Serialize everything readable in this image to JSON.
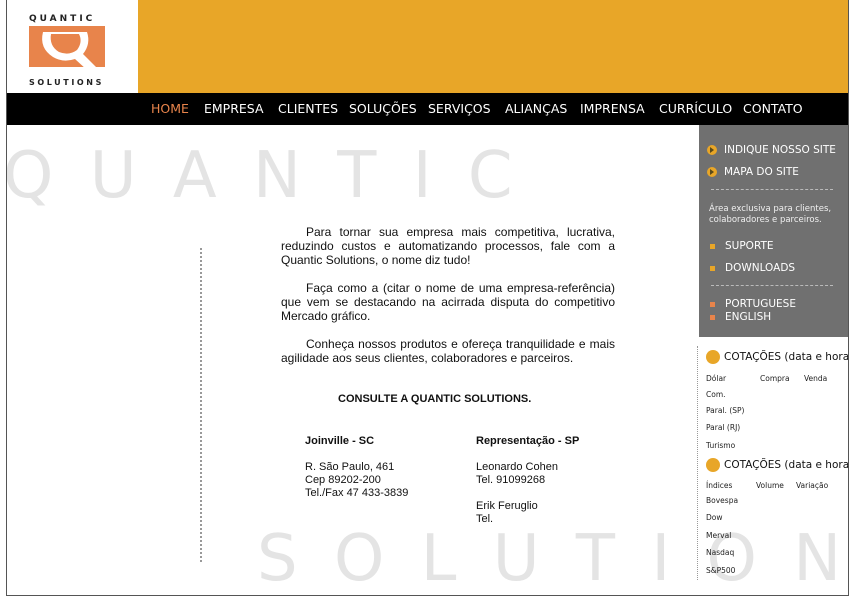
{
  "brand": {
    "logo_top": "QUANTIC",
    "logo_bottom": "SOLUTIONS",
    "primary_color": "#E8A628",
    "accent_color": "#E8844B"
  },
  "nav": {
    "items": [
      {
        "label": "HOME",
        "active": true
      },
      {
        "label": "EMPRESA"
      },
      {
        "label": "CLIENTES"
      },
      {
        "label": "SOLUÇÕES"
      },
      {
        "label": "SERVIÇOS"
      },
      {
        "label": "ALIANÇAS"
      },
      {
        "label": "IMPRENSA"
      },
      {
        "label": "CURRÍCULO"
      },
      {
        "label": "CONTATO"
      }
    ]
  },
  "watermark": {
    "top": "Q U A N T I C",
    "bottom": "S O L U T I O N S"
  },
  "main": {
    "paragraphs": [
      "Para tornar sua empresa mais competitiva, lucrativa, reduzindo custos e automatizando processos, fale com a Quantic Solutions, o nome diz tudo!",
      "Faça como a (citar o nome de uma empresa-referência) que vem se destacando na acirrada disputa do competitivo Mercado gráfico.",
      "Conheça nossos produtos e ofereça tranquilidade e mais agilidade aos seus clientes, colaboradores e parceiros."
    ],
    "consult": "CONSULTE A QUANTIC SOLUTIONS.",
    "offices": [
      {
        "title": "Joinville - SC",
        "lines": [
          "R. São Paulo, 461",
          "Cep  89202-200",
          "Tel./Fax  47 433-3839"
        ]
      },
      {
        "title": "Representação - SP",
        "lines": [
          "Leonardo Cohen",
          "Tel. 91099268",
          "",
          "Erik Feruglio",
          "Tel."
        ]
      }
    ]
  },
  "sidebar": {
    "links": [
      "INDIQUE NOSSO SITE",
      "MAPA DO SITE"
    ],
    "note": "Área exclusiva para clientes, colaboradores e parceiros.",
    "restricted": [
      "SUPORTE",
      "DOWNLOADS"
    ],
    "languages": [
      "PORTUGUESE",
      "ENGLISH"
    ]
  },
  "quotes": {
    "currency": {
      "title": "COTAÇÕES (data e hora)",
      "headers": [
        "Dólar",
        "Compra",
        "Venda"
      ],
      "rows": [
        "Com.",
        "Paral. (SP)",
        "Paral (RJ)",
        "Turismo"
      ]
    },
    "indices": {
      "title": "COTAÇÕES (data e hora)",
      "headers": [
        "Índices",
        "Volume",
        "Variação"
      ],
      "rows": [
        "Bovespa",
        "Dow",
        "Merval",
        "Nasdaq",
        "S&P500"
      ]
    }
  }
}
